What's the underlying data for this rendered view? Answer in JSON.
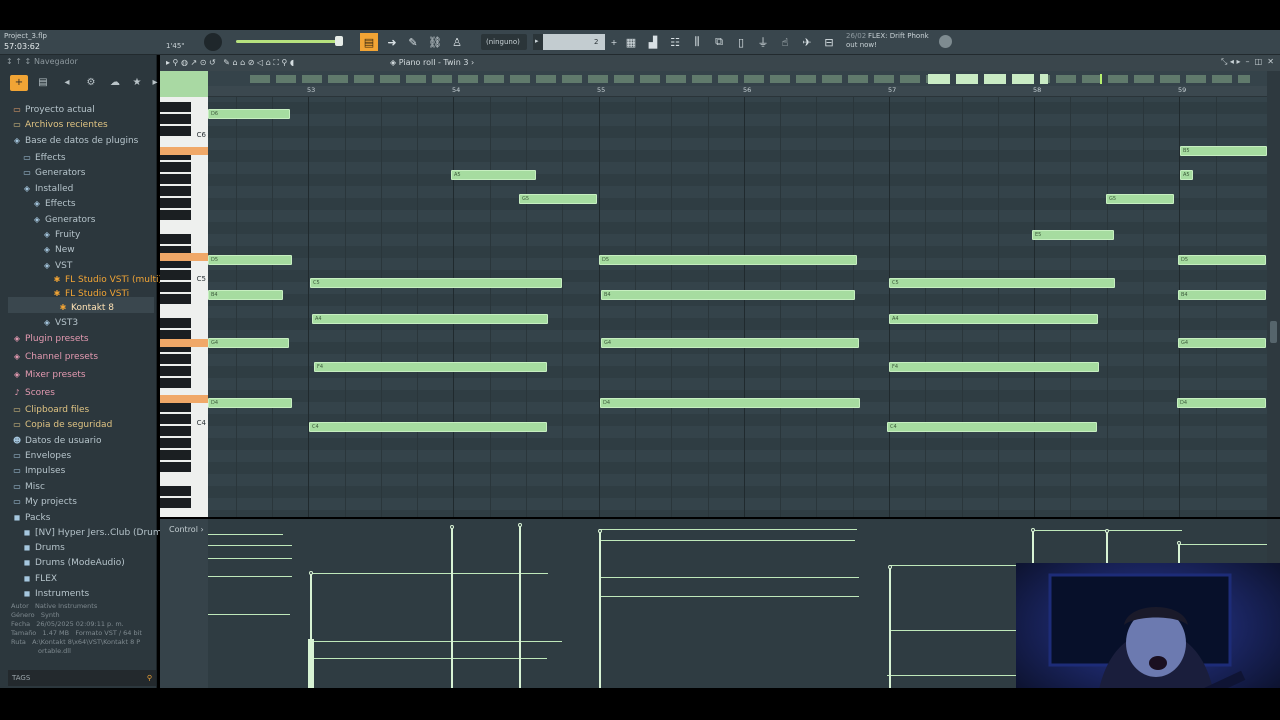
{
  "project": {
    "file": "Project_3.flp",
    "time": "57:03:62",
    "tempo_hint": "1'45\""
  },
  "toolbar": {
    "pattern_select": "(ninguno)",
    "step_value": "2",
    "news_date": "26/02",
    "news_text": "FLEX: Drift Phonk out now!"
  },
  "sidebar": {
    "header": "Navegador",
    "items": [
      {
        "label": "Proyecto actual",
        "icon": "folder-icon"
      },
      {
        "label": "Archivos recientes",
        "icon": "folder-icon"
      },
      {
        "label": "Base de datos de plugins",
        "icon": "plugin-db-icon"
      },
      {
        "label": "Effects",
        "icon": "folder-icon"
      },
      {
        "label": "Generators",
        "icon": "folder-icon"
      },
      {
        "label": "Installed",
        "icon": "plugin-folder-icon"
      },
      {
        "label": "Effects",
        "icon": "plugin-folder-icon"
      },
      {
        "label": "Generators",
        "icon": "plugin-folder-icon"
      },
      {
        "label": "Fruity",
        "icon": "plugin-folder-icon"
      },
      {
        "label": "New",
        "icon": "plugin-folder-icon"
      },
      {
        "label": "VST",
        "icon": "plugin-folder-icon"
      },
      {
        "label": "FL Studio VSTi (multi)",
        "icon": "plugin-icon"
      },
      {
        "label": "FL Studio VSTi",
        "icon": "plugin-icon"
      },
      {
        "label": "Kontakt 8",
        "icon": "plugin-icon"
      },
      {
        "label": "VST3",
        "icon": "plugin-folder-icon"
      },
      {
        "label": "Plugin presets",
        "icon": "preset-icon"
      },
      {
        "label": "Channel presets",
        "icon": "preset-icon"
      },
      {
        "label": "Mixer presets",
        "icon": "preset-icon"
      },
      {
        "label": "Scores",
        "icon": "note-icon"
      },
      {
        "label": "Clipboard files",
        "icon": "folder-icon"
      },
      {
        "label": "Copia de seguridad",
        "icon": "folder-icon"
      },
      {
        "label": "Datos de usuario",
        "icon": "user-icon"
      },
      {
        "label": "Envelopes",
        "icon": "folder-icon"
      },
      {
        "label": "Impulses",
        "icon": "folder-icon"
      },
      {
        "label": "Misc",
        "icon": "folder-icon"
      },
      {
        "label": "My projects",
        "icon": "folder-icon"
      },
      {
        "label": "Packs",
        "icon": "pack-icon"
      },
      {
        "label": "[NV] Hyper Jers..Club (Drum kit)",
        "icon": "pack-icon"
      },
      {
        "label": "Drums",
        "icon": "pack-icon"
      },
      {
        "label": "Drums (ModeAudio)",
        "icon": "pack-icon"
      },
      {
        "label": "FLEX",
        "icon": "pack-icon"
      },
      {
        "label": "Instruments",
        "icon": "pack-icon"
      }
    ],
    "info": {
      "autor_label": "Autor",
      "autor": "Native Instruments",
      "genero_label": "Género",
      "genero": "Synth",
      "fecha_label": "Fecha",
      "fecha": "26/05/2025 02:09:11 p. m.",
      "tamano_label": "Tamaño",
      "tamano": "1.47 MB",
      "formato_label": "Formato",
      "formato": "VST / 64 bit",
      "ruta_label": "Ruta",
      "ruta_1": "A:\\Kontakt 8\\x64\\VST\\Kontakt 8 P",
      "ruta_2": "ortable.dll"
    },
    "tags_label": "TAGS"
  },
  "piano_roll": {
    "title": "Piano roll - Twin 3",
    "ruler": [
      "53",
      "54",
      "55",
      "56",
      "57",
      "58",
      "59"
    ],
    "octave_labels": [
      "C6",
      "C5",
      "C4"
    ],
    "control_label": "Control",
    "notes": [
      {
        "label": "D6"
      },
      {
        "label": "A5"
      },
      {
        "label": "G5"
      },
      {
        "label": "D5"
      },
      {
        "label": "C5"
      },
      {
        "label": "B4"
      },
      {
        "label": "A4"
      },
      {
        "label": "G4"
      },
      {
        "label": "F4"
      },
      {
        "label": "D4"
      },
      {
        "label": "C4"
      },
      {
        "label": "D5"
      },
      {
        "label": "B4"
      },
      {
        "label": "G4"
      },
      {
        "label": "D4"
      },
      {
        "label": "C5"
      },
      {
        "label": "A4"
      },
      {
        "label": "F4"
      },
      {
        "label": "C4"
      },
      {
        "label": "E5"
      },
      {
        "label": "G5"
      },
      {
        "label": "B5"
      },
      {
        "label": "A5"
      },
      {
        "label": "D5"
      },
      {
        "label": "B4"
      },
      {
        "label": "G4"
      },
      {
        "label": "D4"
      }
    ]
  },
  "colors": {
    "note": "#a6dca0",
    "accent": "#f0a868",
    "bg": "#34434a"
  }
}
